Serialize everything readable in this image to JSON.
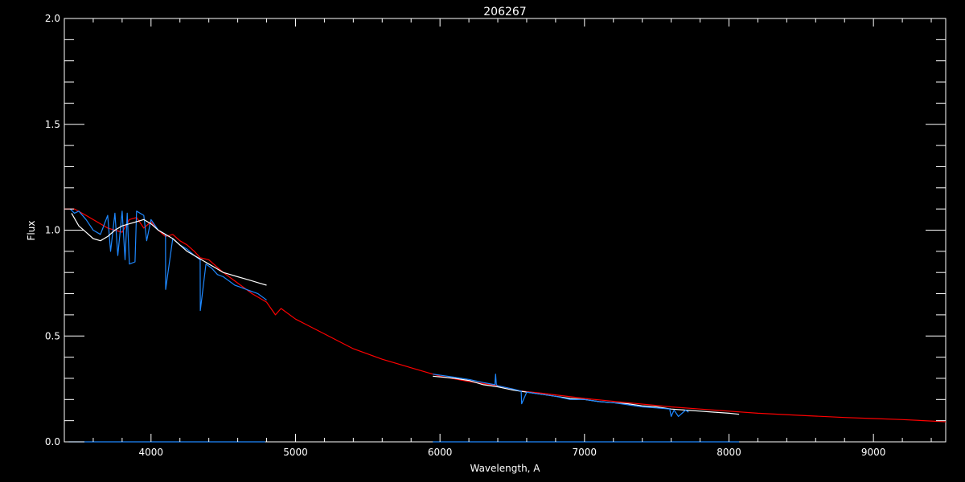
{
  "chart_data": {
    "type": "line",
    "title": "206267",
    "xlabel": "Wavelength, A",
    "ylabel": "Flux",
    "xlim": [
      3400,
      9500
    ],
    "ylim": [
      0.0,
      2.0
    ],
    "x_ticks": [
      4000,
      5000,
      6000,
      7000,
      8000,
      9000
    ],
    "x_tick_labels": [
      "4000",
      "5000",
      "6000",
      "7000",
      "8000",
      "9000"
    ],
    "y_ticks": [
      0.0,
      0.5,
      1.0,
      1.5,
      2.0
    ],
    "y_tick_labels": [
      "0.0",
      "0.5",
      "1.0",
      "1.5",
      "2.0"
    ],
    "grid": false,
    "legend": "none",
    "background": "#000000",
    "axis_color": "#ffffff",
    "series": [
      {
        "color": "#ff0000",
        "x": [
          3400,
          3470,
          3550,
          3650,
          3700,
          3750,
          3800,
          3850,
          3900,
          3950,
          4000,
          4050,
          4100,
          4150,
          4200,
          4250,
          4300,
          4340,
          4400,
          4500,
          4600,
          4700,
          4800,
          4861,
          4900,
          5000,
          5200,
          5400,
          5600,
          5800,
          6000,
          6200,
          6400,
          6563,
          6700,
          7000,
          7300,
          7600,
          7800,
          8000,
          8200,
          8500,
          8800,
          9000,
          9200,
          9500
        ],
        "y": [
          1.1,
          1.1,
          1.07,
          1.03,
          1.01,
          1.0,
          0.99,
          1.05,
          1.06,
          1.01,
          1.04,
          1.0,
          0.97,
          0.98,
          0.95,
          0.93,
          0.9,
          0.87,
          0.86,
          0.8,
          0.75,
          0.7,
          0.66,
          0.6,
          0.63,
          0.58,
          0.51,
          0.44,
          0.39,
          0.35,
          0.31,
          0.285,
          0.265,
          0.24,
          0.23,
          0.205,
          0.185,
          0.165,
          0.155,
          0.145,
          0.135,
          0.125,
          0.115,
          0.11,
          0.105,
          0.095
        ]
      },
      {
        "color": "#1e88ff",
        "x": [
          3440,
          3470,
          3500,
          3550,
          3600,
          3650,
          3700,
          3720,
          3750,
          3770,
          3800,
          3820,
          3835,
          3850,
          3889,
          3900,
          3950,
          3970,
          4000,
          4050,
          4100,
          4101,
          4150,
          4200,
          4250,
          4300,
          4340,
          4341,
          4380,
          4420,
          4460,
          4500,
          4540,
          4580,
          4620,
          4660,
          4700,
          4740,
          4780,
          4800
        ],
        "y": [
          1.1,
          1.08,
          1.09,
          1.05,
          1.0,
          0.98,
          1.07,
          0.9,
          1.08,
          0.88,
          1.09,
          0.86,
          1.08,
          0.84,
          0.85,
          1.09,
          1.07,
          0.95,
          1.05,
          1.0,
          0.98,
          0.72,
          0.96,
          0.93,
          0.91,
          0.88,
          0.86,
          0.62,
          0.84,
          0.82,
          0.79,
          0.78,
          0.76,
          0.74,
          0.73,
          0.72,
          0.71,
          0.7,
          0.68,
          0.67
        ]
      },
      {
        "color": "#ffffff",
        "x": [
          3450,
          3500,
          3550,
          3600,
          3650,
          3700,
          3750,
          3800,
          3850,
          3900,
          3950,
          4000,
          4050,
          4100,
          4150,
          4200,
          4250,
          4300,
          4350,
          4400,
          4450,
          4500,
          4550,
          4600,
          4650,
          4700,
          4750,
          4800
        ],
        "y": [
          1.08,
          1.02,
          0.99,
          0.96,
          0.95,
          0.97,
          1.0,
          1.02,
          1.03,
          1.04,
          1.05,
          1.03,
          1.0,
          0.98,
          0.96,
          0.93,
          0.9,
          0.88,
          0.86,
          0.84,
          0.82,
          0.8,
          0.79,
          0.78,
          0.77,
          0.76,
          0.75,
          0.74
        ]
      },
      {
        "color": "#ffffff",
        "x": [
          5950,
          6100,
          6200,
          6300,
          6400,
          6500,
          6600,
          6700,
          6800,
          6900,
          7000,
          7100,
          7200,
          7300,
          7400,
          7500,
          7600,
          7700,
          7800,
          7900,
          8000,
          8070
        ],
        "y": [
          0.31,
          0.3,
          0.29,
          0.27,
          0.26,
          0.245,
          0.235,
          0.225,
          0.215,
          0.205,
          0.2,
          0.19,
          0.185,
          0.18,
          0.17,
          0.165,
          0.155,
          0.15,
          0.145,
          0.14,
          0.135,
          0.13
        ]
      },
      {
        "color": "#1e88ff",
        "x": [
          5950,
          6100,
          6200,
          6300,
          6380,
          6385,
          6390,
          6400,
          6500,
          6562,
          6565,
          6600,
          6700,
          6800,
          6900,
          7000,
          7100,
          7200,
          7300,
          7400,
          7500,
          7590,
          7600,
          7620,
          7650,
          7700,
          7720
        ],
        "y": [
          0.32,
          0.305,
          0.295,
          0.28,
          0.27,
          0.32,
          0.27,
          0.265,
          0.25,
          0.24,
          0.18,
          0.235,
          0.225,
          0.215,
          0.2,
          0.2,
          0.19,
          0.185,
          0.175,
          0.165,
          0.16,
          0.155,
          0.12,
          0.15,
          0.12,
          0.15,
          0.14
        ]
      },
      {
        "color": "#1e88ff",
        "x": [
          3430,
          4790
        ],
        "y": [
          0.0,
          0.0
        ]
      },
      {
        "color": "#1e88ff",
        "x": [
          5950,
          8070
        ],
        "y": [
          0.0,
          0.0
        ]
      }
    ]
  }
}
